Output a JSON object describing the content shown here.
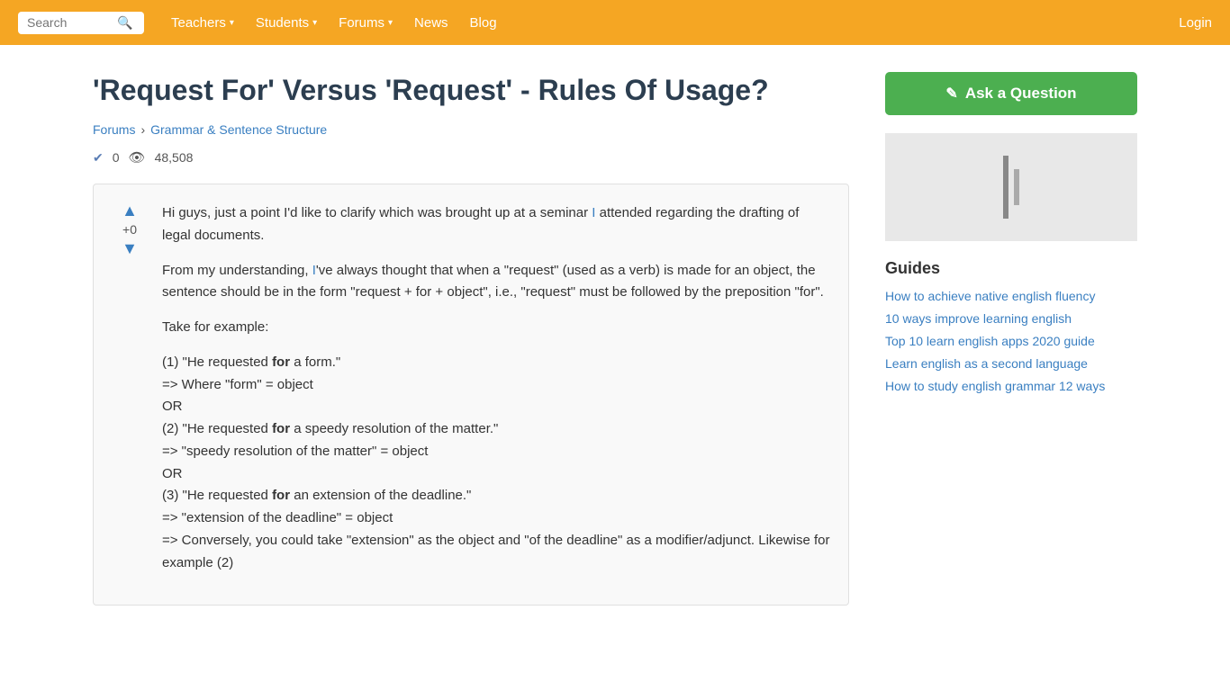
{
  "nav": {
    "search_placeholder": "Search",
    "links": [
      {
        "label": "Teachers",
        "has_dropdown": true
      },
      {
        "label": "Students",
        "has_dropdown": true
      },
      {
        "label": "Forums",
        "has_dropdown": true
      },
      {
        "label": "News",
        "has_dropdown": false
      },
      {
        "label": "Blog",
        "has_dropdown": false
      }
    ],
    "login_label": "Login"
  },
  "page": {
    "title": "'Request For' Versus 'Request' - Rules Of Usage?",
    "breadcrumb": {
      "forums_label": "Forums",
      "separator": "›",
      "category_label": "Grammar & Sentence Structure"
    },
    "meta": {
      "votes": "0",
      "views": "48,508"
    }
  },
  "post": {
    "vote_up": "▲",
    "vote_down": "▼",
    "vote_label": "+0",
    "body_paragraphs": [
      "Hi guys, just a point I'd like to clarify which was brought up at a seminar I attended regarding the drafting of legal documents.",
      "From my understanding, I've always thought that when a \"request\" (used as a verb) is made for an object, the sentence should be in the form \"request + for + object\", i.e., \"request\" must be followed by the preposition \"for\".",
      "Take for example:",
      "(1) \"He requested for a form.\"\n=> Where \"form\" = object\nOR\n(2) \"He requested for a speedy resolution of the matter.\"\n=> \"speedy resolution of the matter\" = object\nOR\n(3) \"He requested for an extension of the deadline.\"\n=> \"extension of the deadline\" = object\n=> Conversely, you could take \"extension\" as the object and \"of the deadline\" as a modifier/adjunct. Likewise for example (2)"
    ]
  },
  "sidebar": {
    "ask_button_label": "Ask a Question",
    "guides_title": "Guides",
    "guide_links": [
      "How to achieve native english fluency",
      "10 ways improve learning english",
      "Top 10 learn english apps 2020 guide",
      "Learn english as a second language",
      "How to study english grammar 12 ways"
    ]
  }
}
